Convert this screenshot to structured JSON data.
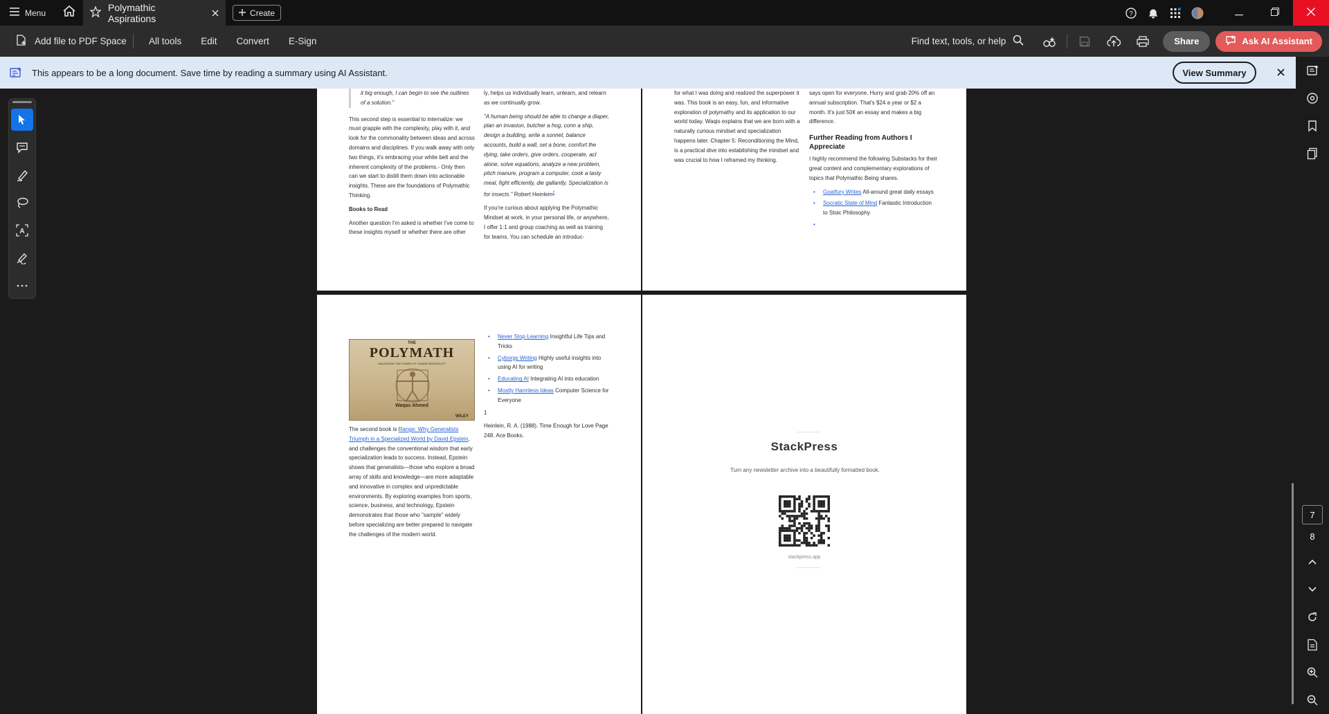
{
  "titlebar": {
    "menu_label": "Menu",
    "tab_title": "Polymathic Aspirations",
    "create_label": "Create"
  },
  "toolbar": {
    "add_file_label": "Add file to PDF Space",
    "menus": [
      "All tools",
      "Edit",
      "Convert",
      "E-Sign"
    ],
    "find_label": "Find text, tools, or help",
    "share_label": "Share",
    "ai_label": "Ask AI Assistant"
  },
  "banner": {
    "message": "This appears to be a long document. Save time by reading a summary using AI Assistant.",
    "view_summary_label": "View Summary"
  },
  "page_nav": {
    "current_page": "7",
    "next_page": "8"
  },
  "pages": {
    "p5_col1": {
      "quote_fragment": "it big enough, I can begin to see the outlines of a solution.\"",
      "paragraph": "This second step is essential to internalize: we must grapple with the complexity, play with it, and look for the commonality between ideas and across domains and disciplines. If you walk away with only two things, it's embracing your white belt and the inherent complexity of the problems.- Only then can we start to distill them down into actionable insights. These are the foundations of Polymathic Thinking.",
      "heading": "Books to Read",
      "paragraph2": "Another question I'm asked is whether I've come to these insights myself or whether there are other"
    },
    "p5_col2": {
      "fragment": "ly, helps us individually learn, unlearn, and relearn as we continually grow.",
      "quote": "\"A human being should be able to change a diaper, plan an invasion, butcher a hog, conn a ship, design a building, write a sonnet, balance accounts, build a wall, set a bone, comfort the dying, take orders, give orders, cooperate, act alone, solve equations, analyze a new problem, pitch manure, program a computer, cook a tasty meal, fight efficiently, die gallantly. Specialization is for insects.\"",
      "quote_author": "Robert Heinlein",
      "footnote_mark": "1",
      "paragraph": "If you're curious about applying the Polymathic Mindset at work, in your personal life, or anywhere, I offer 1:1 and group coaching as well as training for teams. You can schedule an introduc-"
    },
    "p6_col1": {
      "paragraph": "for what I was doing and realized the superpower it was. This book is an easy, fun, and informative exploration of polymathy and its application to our world today. Waqis explains that we are born with a naturally curious mindset and specialization happens later. Chapter 5: Reconditioning the Mind, is a practical dive into establishing the mindset and was crucial to how I reframed my thinking."
    },
    "p6_col2": {
      "paragraph": "says open for everyone. Hurry and grab 20% off an annual subscription. That's $24 a year or $2 a month. It's just 50¢ an essay and makes a big difference.",
      "heading": "Further Reading from Authors I Appreciate",
      "intro": "I highly recommend the following Substacks for their great content and complementary explorations of topics that Polymathic Being shares.",
      "list": [
        {
          "link": "Goatfury Writes",
          "text": " All-around great daily essays"
        },
        {
          "link": "Socratic State of Mind",
          "text": " Fantastic Introduction to Stoic Philosophy"
        },
        {
          "link": "",
          "text": ""
        }
      ]
    },
    "p7_col1": {
      "cover_the": "THE",
      "cover_title": "POLYMATH",
      "cover_subtitle": "UNLOCKING THE POWER OF HUMAN VERSATILITY",
      "cover_author": "Waqas Ahmed",
      "cover_publisher": "WILEY",
      "para_pre": "The second book is ",
      "para_link": "Range: Why Generalists Triumph in a Specialized World by David Epstein",
      "para_post": ", and challenges the conventional wisdom that early specialization leads to success. Instead, Epstein shows that generalists—those who explore a broad array of skills and knowledge—are more adaptable and innovative in complex and unpredictable environments. By exploring examples from sports, science, business, and technology, Epstein demonstrates that those who \"sample\" widely before specializing are better prepared to navigate the challenges of the modern world."
    },
    "p7_col2": {
      "list": [
        {
          "link": "Never Stop Learning",
          "text": " Insightful Life Tips and Tricks"
        },
        {
          "link": "Cyborgs Writing",
          "text": " Highly useful insights into using AI for writing"
        },
        {
          "link": "Educating AI",
          "text": " Integrating AI into education"
        },
        {
          "link": "Mostly Harmless Ideas",
          "text": " Computer Science for Everyone"
        }
      ],
      "footnote_number": "1",
      "footnote": "Heinlein, R. A. (1988). Time Enough for Love Page 248. Ace Books."
    },
    "p8": {
      "title": "StackPress",
      "subtitle": "Turn any newsletter archive into a beautifully formatted book.",
      "url": "stackpress.app"
    }
  },
  "colors": {
    "accent": "#1473e6",
    "ai_button": "#e25a5a",
    "banner_bg": "#dde8f6",
    "link": "#2563d6"
  }
}
